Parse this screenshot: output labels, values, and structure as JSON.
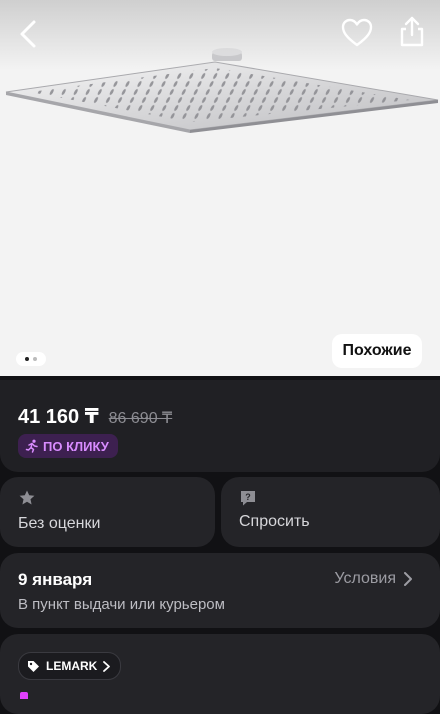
{
  "hero": {
    "similar_label": "Похожие",
    "gallery_dots": 2,
    "active_dot": 0
  },
  "price": {
    "current": "41 160 ₸",
    "old": "86 690 ₸",
    "promo_label": "ПО КЛИКУ",
    "promo_color": "#d98cff"
  },
  "rating": {
    "label": "Без оценки"
  },
  "ask": {
    "label": "Спросить"
  },
  "delivery": {
    "date": "9 января",
    "subtitle": "В пункт выдачи или курьером",
    "conditions_label": "Условия"
  },
  "brand": {
    "name": "LEMARK"
  },
  "icons": [
    "back-arrow-icon",
    "heart-icon",
    "share-icon",
    "star-icon",
    "question-bubble-icon",
    "tag-icon",
    "chevron-right-icon"
  ]
}
